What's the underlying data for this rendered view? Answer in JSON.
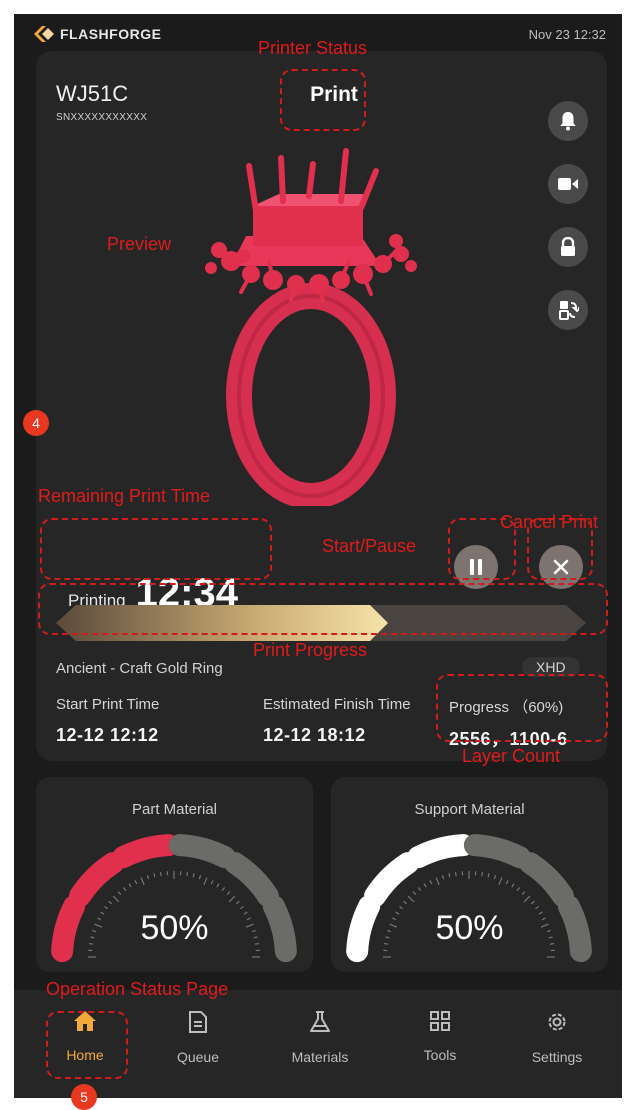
{
  "header": {
    "brand": "FLASHFORGE",
    "datetime": "Nov 23  12:32"
  },
  "printer": {
    "model": "WJ51C",
    "serial": "SNXXXXXXXXXXX",
    "status": "Print"
  },
  "side_buttons": [
    {
      "icon": "bell-icon"
    },
    {
      "icon": "camera-icon"
    },
    {
      "icon": "lock-icon"
    },
    {
      "icon": "swap-icon"
    }
  ],
  "job": {
    "printing_label": "Printing",
    "remaining_time": "12:34",
    "name": "Ancient - Craft Gold Ring",
    "quality": "XHD",
    "progress_fraction": 0.6,
    "start_label": "Start Print Time",
    "start_value": "12-12 12:12",
    "finish_label": "Estimated Finish Time",
    "finish_value": "12-12 18:12",
    "progress_label": "Progress （60%)",
    "layer_value": "2556，1100-6"
  },
  "annotations": {
    "printer_status": "Printer Status",
    "preview": "Preview",
    "remaining": "Remaining Print Time",
    "cancel": "Cancel Print",
    "start_pause": "Start/Pause",
    "progress": "Print Progress",
    "layer_count": "Layer Count",
    "operation": "Operation Status Page",
    "badge4": "4",
    "badge5": "5"
  },
  "materials": [
    {
      "title": "Part Material",
      "percent": "50%",
      "level": 0.5,
      "color": "#e0304e"
    },
    {
      "title": "Support Material",
      "percent": "50%",
      "level": 0.5,
      "color": "#ffffff"
    }
  ],
  "nav": [
    {
      "label": "Home",
      "icon": "home-icon",
      "active": true
    },
    {
      "label": "Queue",
      "icon": "document-icon",
      "active": false
    },
    {
      "label": "Materials",
      "icon": "flask-icon",
      "active": false
    },
    {
      "label": "Tools",
      "icon": "grid-icon",
      "active": false
    },
    {
      "label": "Settings",
      "icon": "gear-icon",
      "active": false
    }
  ],
  "colors": {
    "accent": "#f2a93b",
    "annotation": "#e01b1b",
    "ring": "#e0304e"
  }
}
